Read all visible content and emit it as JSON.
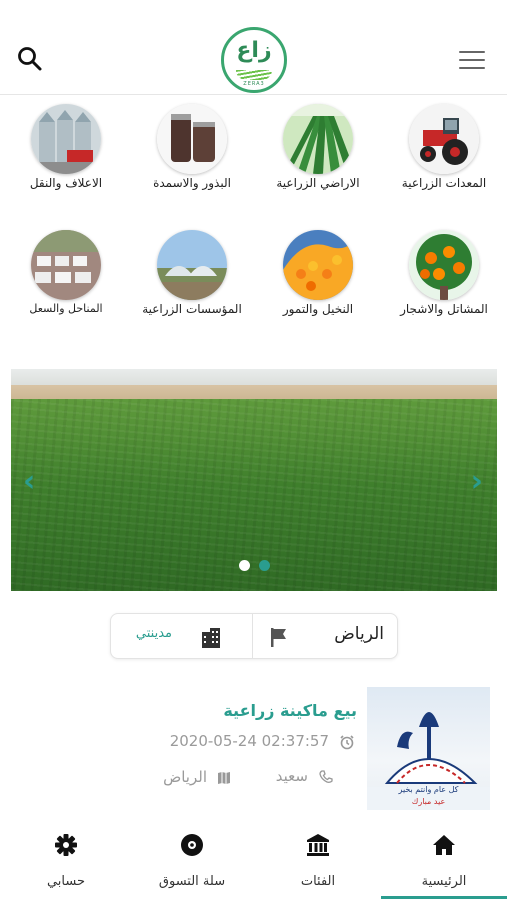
{
  "header": {
    "logo_glyph": "زاع",
    "logo_tag": "ZERA3"
  },
  "categories": [
    {
      "label": "المعدات الزراعية",
      "icon": "tractor"
    },
    {
      "label": "الاراضي الزراعية",
      "icon": "crop-rows"
    },
    {
      "label": "البذور والاسمدة",
      "icon": "seed-jars"
    },
    {
      "label": "الاعلاف والنقل",
      "icon": "silos-truck"
    },
    {
      "label": "المشاتل والاشجار",
      "icon": "orange-tree"
    },
    {
      "label": "النخيل والتمور",
      "icon": "dates"
    },
    {
      "label": "المؤسسات الزراعية",
      "icon": "greenhouse"
    },
    {
      "label": "المناحل والسعل",
      "icon": "beehives"
    }
  ],
  "banner": {
    "slide_count": 2,
    "active_slide": 2,
    "colors": {
      "dot_active": "#2a9d8f",
      "dot_inactive": "#ffffff",
      "arrow": "#2a9d8f"
    }
  },
  "filter": {
    "region": "الرياض",
    "city": "مدينتي"
  },
  "listing": {
    "title": "بيع ماكينة زراعية",
    "datetime": "2020-05-24 02:37:57",
    "seller": "سعيد",
    "location": "الرياض",
    "thumb_caption_1": "كل عام وانتم بخير",
    "thumb_caption_2": "عيد مبارك"
  },
  "nav": {
    "home": "الرئيسية",
    "categories": "الفئات",
    "cart": "سلة التسوق",
    "account": "حسابي",
    "active": "home"
  },
  "colors": {
    "accent": "#2a9d8f",
    "brand": "#3aa66f"
  }
}
